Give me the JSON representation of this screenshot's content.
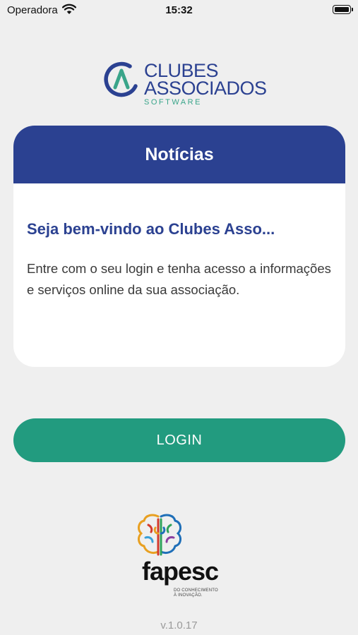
{
  "status_bar": {
    "carrier": "Operadora",
    "time": "15:32"
  },
  "logo": {
    "line1": "CLUBES",
    "line2": "ASSOCIADOS",
    "subtitle": "SOFTWARE",
    "colors": {
      "primary": "#2b4191",
      "accent": "#3aa58a"
    }
  },
  "news": {
    "header": "Notícias",
    "title": "Seja bem-vindo ao Clubes Asso...",
    "body": "Entre com o seu login e tenha acesso a informações e serviços online da sua associação."
  },
  "login": {
    "label": "LOGIN",
    "color": "#229b7f"
  },
  "sponsor": {
    "name": "fapesc",
    "tagline_line1": "DO CONHECIMENTO",
    "tagline_line2": "À INOVAÇÃO."
  },
  "version": "v.1.0.17"
}
